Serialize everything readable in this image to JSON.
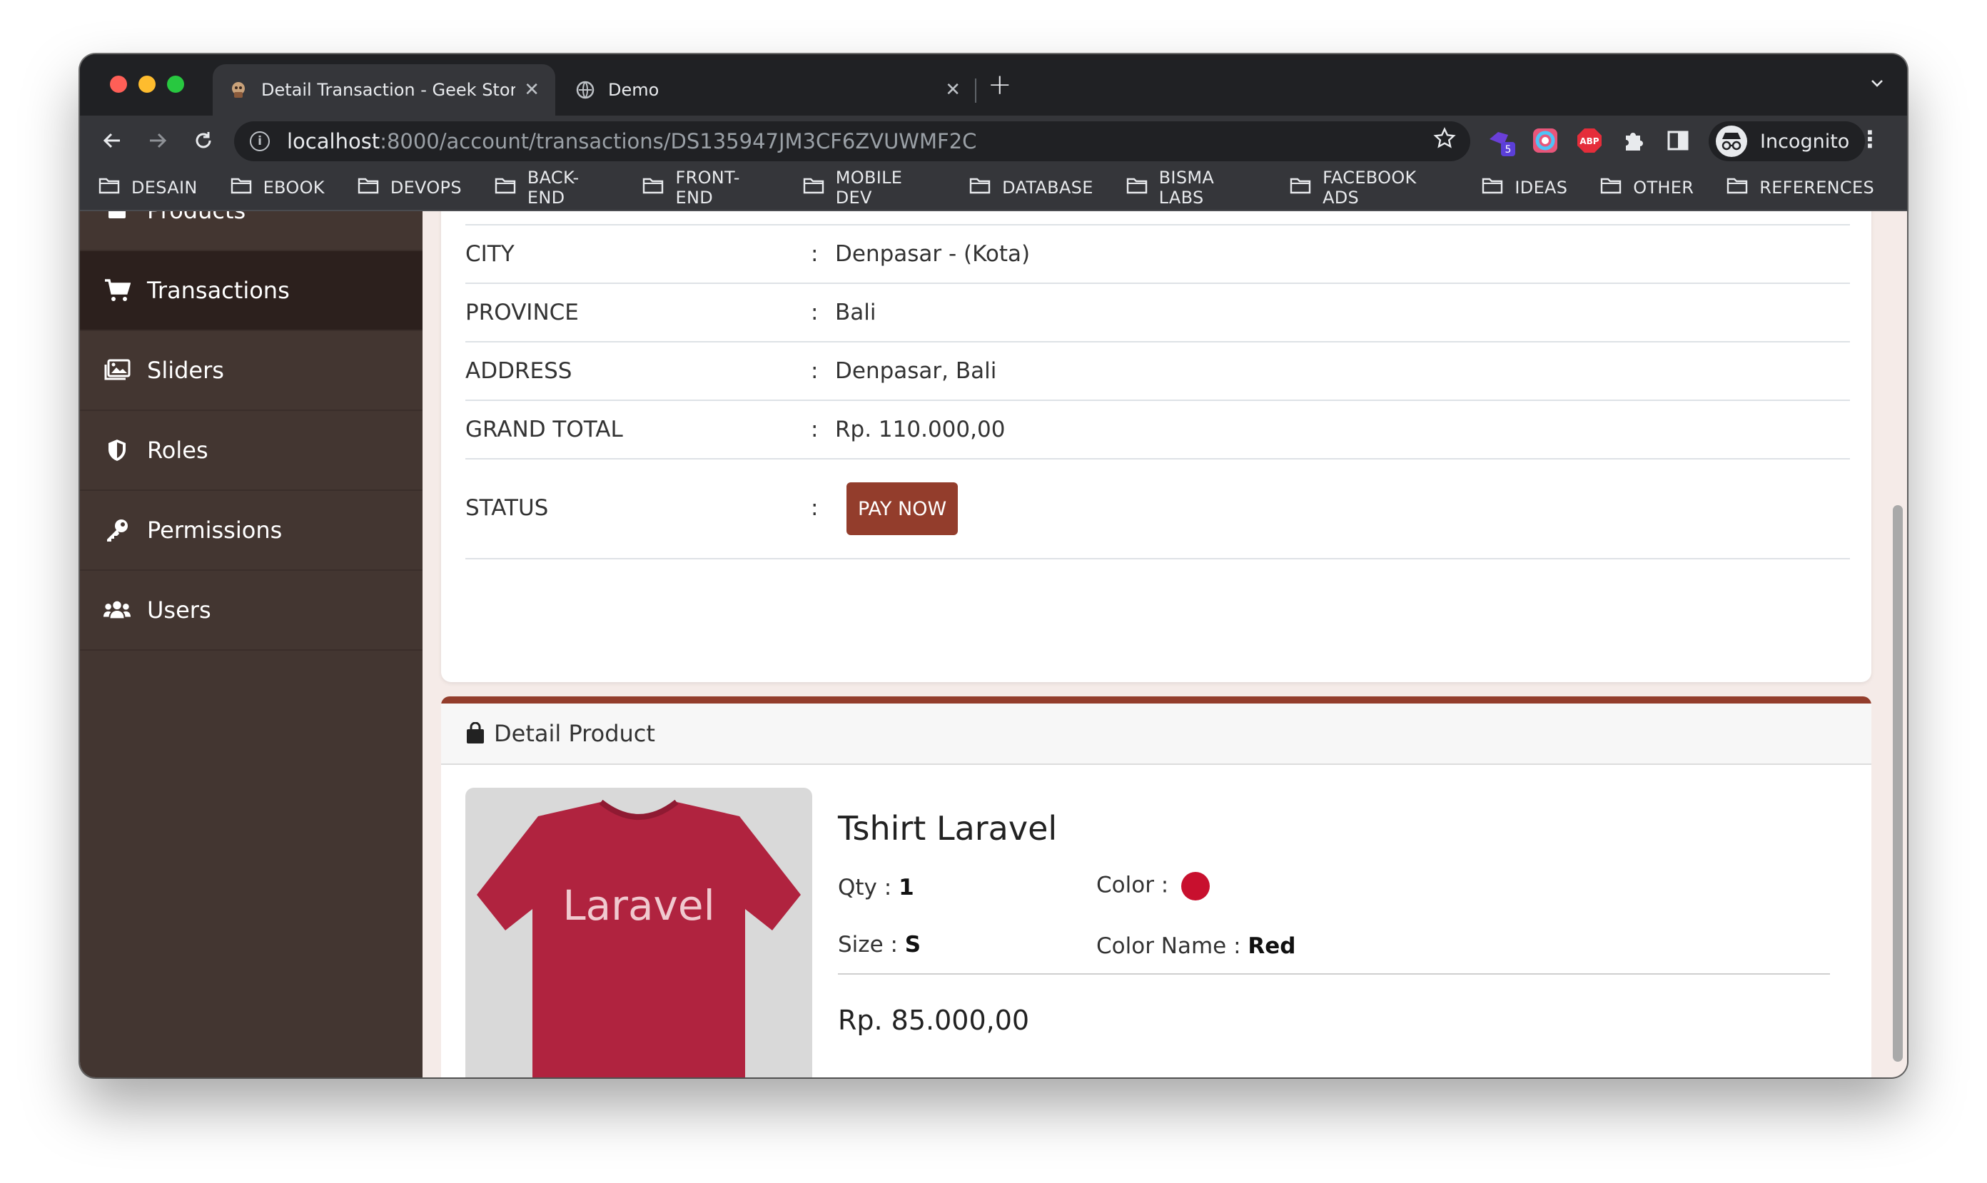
{
  "browser": {
    "tabs": [
      {
        "title": "Detail Transaction - Geek Store",
        "close": "✕"
      },
      {
        "title": "Demo",
        "close": "✕"
      }
    ],
    "new_tab": "+",
    "url_host": "localhost",
    "url_path": ":8000/account/transactions/DS135947JM3CF6ZVUWMF2C",
    "extension_badge": "5",
    "profile_label": "Incognito",
    "bookmarks": [
      "DESAIN",
      "EBOOK",
      "DEVOPS",
      "BACK-END",
      "FRONT-END",
      "MOBILE DEV",
      "DATABASE",
      "BISMA LABS",
      "FACEBOOK ADS",
      "IDEAS",
      "OTHER",
      "REFERENCES"
    ]
  },
  "sidebar": {
    "items": [
      {
        "label": "Products",
        "icon": "box-icon"
      },
      {
        "label": "Transactions",
        "icon": "cart-icon",
        "active": true
      },
      {
        "label": "Sliders",
        "icon": "images-icon"
      },
      {
        "label": "Roles",
        "icon": "shield-icon"
      },
      {
        "label": "Permissions",
        "icon": "key-icon"
      },
      {
        "label": "Users",
        "icon": "users-icon"
      }
    ]
  },
  "transaction": {
    "rows": [
      {
        "label": "CITY",
        "value": "Denpasar - (Kota)"
      },
      {
        "label": "PROVINCE",
        "value": "Bali"
      },
      {
        "label": "ADDRESS",
        "value": "Denpasar, Bali"
      },
      {
        "label": "GRAND TOTAL",
        "value": "Rp. 110.000,00"
      }
    ],
    "status_label": "STATUS",
    "separator": ":",
    "pay_button": "PAY NOW"
  },
  "detail_product": {
    "header": "Detail Product",
    "name": "Tshirt Laravel",
    "image_text": "Laravel",
    "qty_label": "Qty : ",
    "qty": "1",
    "size_label": "Size : ",
    "size": "S",
    "color_label": "Color : ",
    "color_hex": "#c8102e",
    "color_name_label": "Color Name : ",
    "color_name": "Red",
    "price": "Rp. 85.000,00"
  },
  "colors": {
    "accent": "#933d2c",
    "sidebar_bg": "#433631",
    "sidebar_active": "#2c201d",
    "page_bg": "#f5ebe8"
  }
}
